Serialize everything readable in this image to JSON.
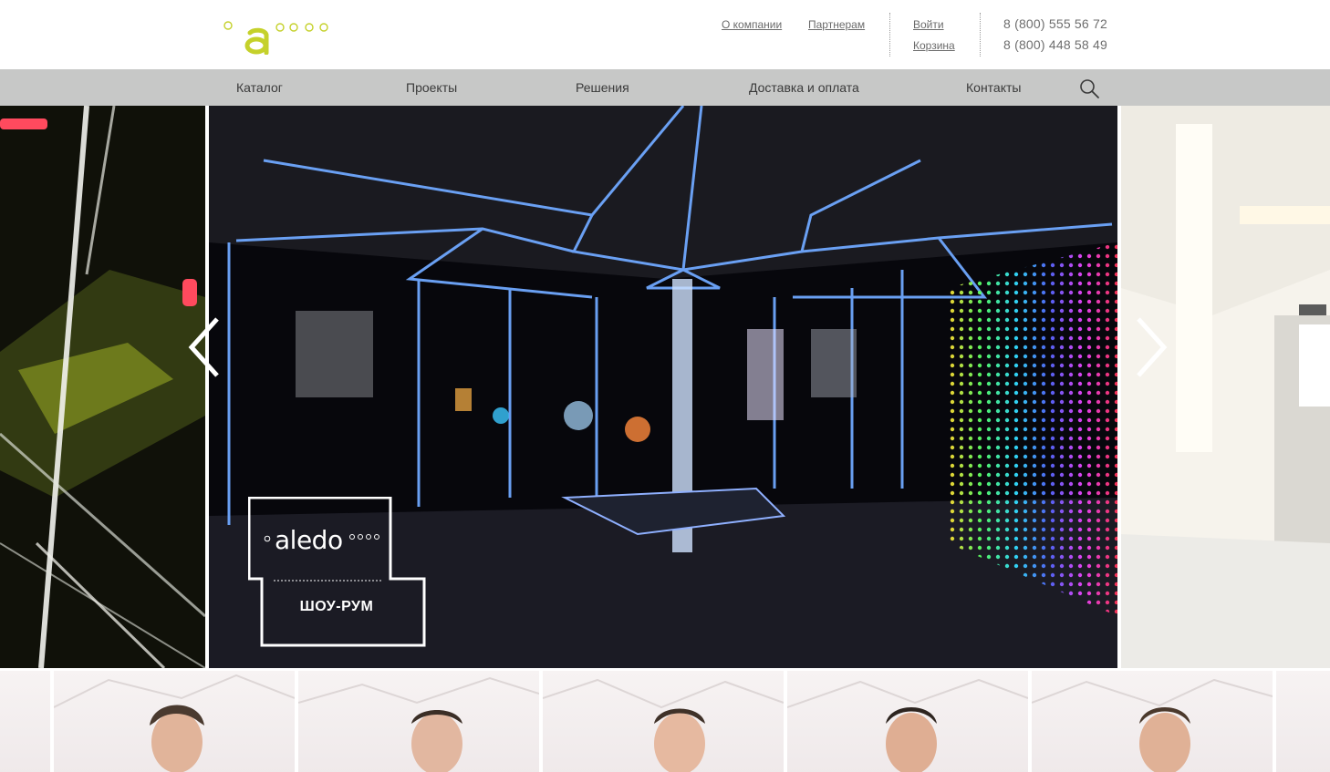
{
  "header": {
    "links": [
      {
        "label": "О компании"
      },
      {
        "label": "Партнерам"
      },
      {
        "label": "Войти"
      },
      {
        "label": "Корзина"
      }
    ],
    "phones": [
      "8 (800) 555 56 72",
      "8 (800) 448 58 49"
    ]
  },
  "nav": {
    "items": [
      "Каталог",
      "Проекты",
      "Решения",
      "Доставка и оплата",
      "Контакты"
    ]
  },
  "slider": {
    "badge_brand": "aledo",
    "badge_caption": "ШОУ-РУМ"
  },
  "colors": {
    "accent": "#c5d12b",
    "navbar": "#c7c8c7",
    "text": "#6b6b6b"
  },
  "icons": [
    "logo",
    "search-icon",
    "arrow-left-icon",
    "arrow-right-icon"
  ]
}
